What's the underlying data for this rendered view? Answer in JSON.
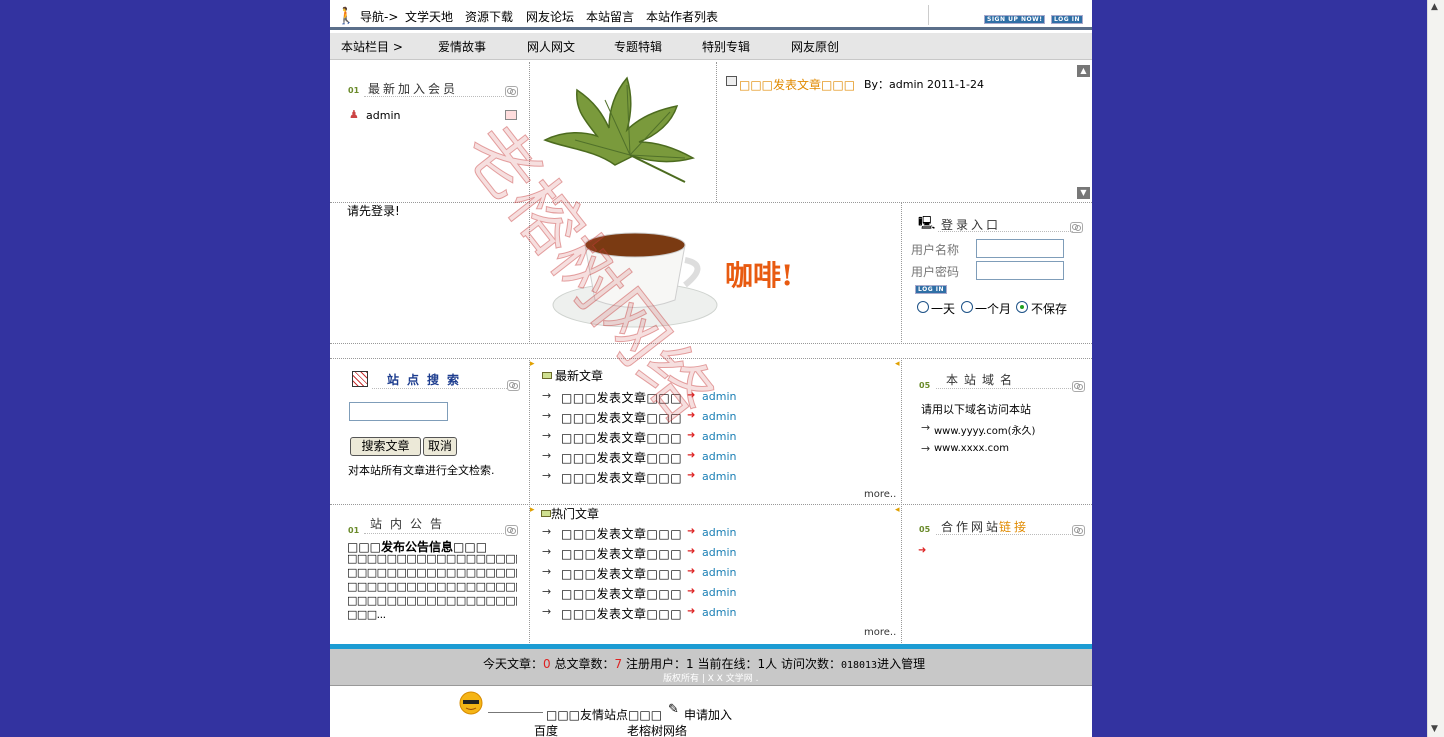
{
  "topnav": {
    "nav_label": "导航->",
    "links": [
      "文学天地",
      "资源下载",
      "网友论坛",
      "本站留言",
      "本站作者列表"
    ],
    "signup_label": "SIGN UP NOW!",
    "login_label": "LOG IN"
  },
  "subnav": {
    "label": "本站栏目 >",
    "items": [
      "爱情故事",
      "网人网文",
      "专题特辑",
      "特别专辑",
      "网友原创"
    ]
  },
  "members": {
    "title": "最新加入会员",
    "num": "01",
    "users": [
      "admin"
    ]
  },
  "featured": {
    "title": "□□□发表文章□□□",
    "byline": "By：admin 2011-1-24"
  },
  "login_notice": "请先登录!",
  "coffee_caption": "咖啡!",
  "login": {
    "title": "登录入口",
    "username_label": "用户名称",
    "password_label": "用户密码",
    "login_btn": "LOG IN",
    "options": [
      "一天",
      "一个月",
      "不保存"
    ],
    "selected": "不保存"
  },
  "search": {
    "title": "站点搜索",
    "submit": "搜索文章",
    "cancel": "取消",
    "hint": "对本站所有文章进行全文检索."
  },
  "latest": {
    "title": "最新文章",
    "items": [
      {
        "title": "□□□发表文章□□□",
        "author": "admin"
      },
      {
        "title": "□□□发表文章□□□",
        "author": "admin"
      },
      {
        "title": "□□□发表文章□□□",
        "author": "admin"
      },
      {
        "title": "□□□发表文章□□□",
        "author": "admin"
      },
      {
        "title": "□□□发表文章□□□",
        "author": "admin"
      }
    ],
    "more": "more.."
  },
  "domain": {
    "title": "本站域名",
    "num": "05",
    "intro": "请用以下域名访问本站",
    "links": [
      "www.yyyy.com(永久)",
      "www.xxxx.com"
    ]
  },
  "notice": {
    "title": "站内公告",
    "num": "01",
    "heading": "□□□发布公告信息□□□",
    "lines": [
      "□□□□□□□□□□□□□□□□□□□□□□□□□",
      "□□□□□□□□□□□□□□□□□□□□□□□□□",
      "□□□□□□□□□□□□□□□□□□□□□□□□□",
      "□□□□□□□□□□□□□□□□□□□□□□□□□",
      "□□□..."
    ]
  },
  "hot": {
    "title": "热门文章",
    "items": [
      {
        "title": "□□□发表文章□□□",
        "author": "admin"
      },
      {
        "title": "□□□发表文章□□□",
        "author": "admin"
      },
      {
        "title": "□□□发表文章□□□",
        "author": "admin"
      },
      {
        "title": "□□□发表文章□□□",
        "author": "admin"
      },
      {
        "title": "□□□发表文章□□□",
        "author": "admin"
      }
    ],
    "more": "more.."
  },
  "partners": {
    "title_a": "合作网站",
    "title_b": "链接",
    "num": "05"
  },
  "stats": {
    "today_label": "今天文章：",
    "today": "0",
    "total_label": "总文章数：",
    "total": "7",
    "users_label": "注册用户：",
    "users": "1",
    "online_label": "当前在线：",
    "online": "1人",
    "visits_label": "访问次数：",
    "visits": "018013",
    "admin_link": "进入管理",
    "copyright": "版权所有 | X X 文学网 ."
  },
  "friends": {
    "title": "□□□友情站点□□□",
    "apply": "申请加入",
    "links": [
      "百度",
      "老榕树网络"
    ]
  },
  "watermark": "老榕树网络",
  "colors": {
    "background": "#3333a0",
    "accent": "#1c9cd3",
    "featured_title": "#e08a00",
    "author": "#1a7fb5"
  }
}
